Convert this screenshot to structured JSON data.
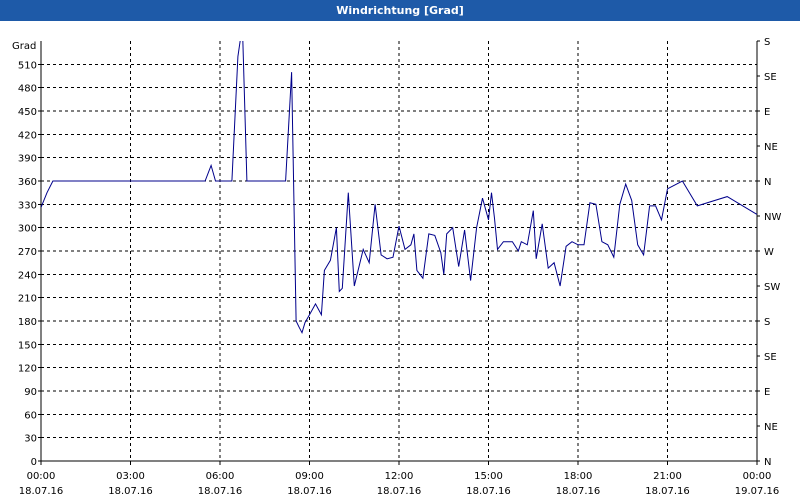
{
  "title": "Windrichtung [Grad]",
  "chart_data": {
    "type": "line",
    "ylabel": "Grad",
    "ylim": [
      0,
      540
    ],
    "y_ticks": [
      0,
      30,
      60,
      90,
      120,
      150,
      180,
      210,
      240,
      270,
      300,
      330,
      360,
      390,
      420,
      450,
      480,
      510
    ],
    "right_axis_labels": [
      "N",
      "NE",
      "E",
      "SE",
      "S",
      "SW",
      "W",
      "NW",
      "N",
      "NE",
      "E",
      "SE",
      "S"
    ],
    "x_tick_labels": [
      {
        "time": "00:00",
        "date": "18.07.16"
      },
      {
        "time": "03:00",
        "date": "18.07.16"
      },
      {
        "time": "06:00",
        "date": "18.07.16"
      },
      {
        "time": "09:00",
        "date": "18.07.16"
      },
      {
        "time": "12:00",
        "date": "18.07.16"
      },
      {
        "time": "15:00",
        "date": "18.07.16"
      },
      {
        "time": "18:00",
        "date": "18.07.16"
      },
      {
        "time": "21:00",
        "date": "18.07.16"
      },
      {
        "time": "00:00",
        "date": "19.07.16"
      }
    ],
    "x_range_hours": [
      0,
      24
    ],
    "grid": true,
    "line_color": "#00008b",
    "series": [
      {
        "x_hours": [
          0,
          0.2,
          0.4,
          0.6,
          0.8,
          1.0,
          1.2,
          1.4,
          1.5,
          1.6,
          1.8,
          1.9,
          2.0,
          2.2,
          2.4,
          2.6,
          2.8,
          3.0,
          3.5,
          4.0,
          4.5,
          5.0,
          5.5,
          5.7,
          5.85,
          6.0,
          6.2,
          6.4,
          6.6,
          6.75,
          6.9,
          7.1,
          7.3,
          7.6,
          7.9,
          8.2,
          8.4,
          8.55,
          8.65,
          8.75,
          8.85,
          9.0,
          9.2,
          9.4,
          9.5,
          9.7,
          9.9,
          10.0,
          10.1,
          10.3,
          10.5,
          10.8,
          11.0,
          11.2,
          11.4,
          11.6,
          11.8,
          12.0,
          12.2,
          12.4,
          12.5,
          12.6,
          12.8,
          13.0,
          13.2,
          13.4,
          13.5,
          13.6,
          13.8,
          14.0,
          14.2,
          14.4,
          14.6,
          14.8,
          15.0,
          15.1,
          15.2,
          15.3,
          15.5,
          15.8,
          16.0,
          16.1,
          16.3,
          16.5,
          16.6,
          16.8,
          17.0,
          17.2,
          17.4,
          17.6,
          17.8,
          18.0,
          18.2,
          18.4,
          18.6,
          18.8,
          19.0,
          19.2,
          19.4,
          19.6,
          19.8,
          20.0,
          20.2,
          20.4,
          20.6,
          20.8,
          21.0,
          21.5,
          22.0,
          23.0,
          24.0
        ],
        "values": [
          326,
          345,
          360,
          360,
          360,
          360,
          360,
          360,
          360,
          360,
          360,
          360,
          360,
          360,
          360,
          360,
          360,
          360,
          360,
          360,
          360,
          360,
          360,
          380,
          360,
          360,
          360,
          360,
          520,
          560,
          360,
          360,
          360,
          360,
          360,
          360,
          500,
          180,
          172,
          165,
          178,
          188,
          202,
          188,
          245,
          258,
          300,
          218,
          222,
          345,
          225,
          272,
          255,
          330,
          265,
          260,
          262,
          302,
          272,
          278,
          292,
          245,
          235,
          292,
          290,
          268,
          240,
          292,
          300,
          250,
          297,
          232,
          300,
          338,
          310,
          345,
          312,
          272,
          282,
          282,
          270,
          282,
          278,
          322,
          260,
          305,
          248,
          255,
          225,
          276,
          282,
          278,
          278,
          332,
          330,
          282,
          278,
          262,
          330,
          356,
          335,
          278,
          265,
          328,
          328,
          310,
          350,
          360,
          328,
          340,
          317,
          360,
          360,
          360
        ]
      }
    ]
  }
}
